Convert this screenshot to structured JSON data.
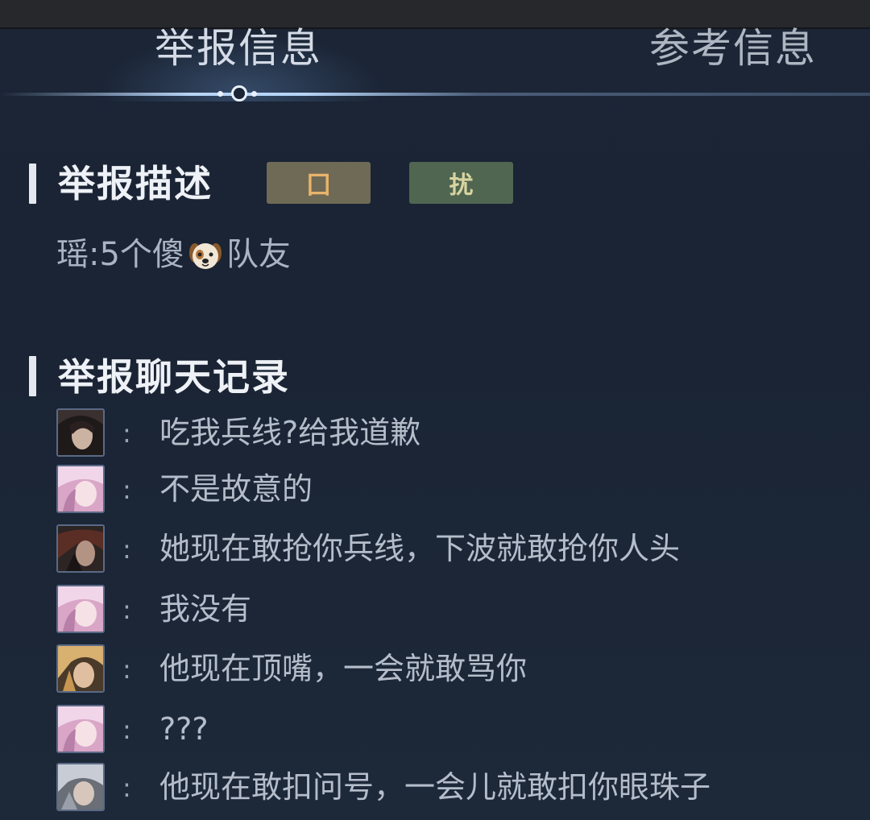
{
  "tabs": {
    "active_label": "举报信息",
    "inactive_label": "参考信息"
  },
  "report_description": {
    "title": "举报描述",
    "tags": [
      "囗",
      "扰"
    ],
    "text_before_icon": "瑶:5个傻",
    "icon": "dog-icon",
    "text_after_icon": "队友"
  },
  "chat_log": {
    "title": "举报聊天记录",
    "messages": [
      {
        "avatar": "avatar-dark-hooded",
        "colon": ":",
        "text": "吃我兵线?给我道歉"
      },
      {
        "avatar": "avatar-pink-yao",
        "colon": ":",
        "text": "不是故意的"
      },
      {
        "avatar": "avatar-dark-warrior",
        "colon": ":",
        "text": "她现在敢抢你兵线，下波就敢抢你人头"
      },
      {
        "avatar": "avatar-pink-yao",
        "colon": ":",
        "text": "我没有"
      },
      {
        "avatar": "avatar-blonde-hero",
        "colon": ":",
        "text": "他现在顶嘴，一会就敢骂你"
      },
      {
        "avatar": "avatar-pink-yao",
        "colon": ":",
        "text": "???"
      },
      {
        "avatar": "avatar-silver-hero",
        "colon": ":",
        "text": "他现在敢扣问号，一会儿就敢扣你眼珠子"
      }
    ]
  },
  "colors": {
    "background": "#1b2536",
    "tag_1_bg": "#6f6a56",
    "tag_2_bg": "#506650",
    "divider_glow": "#bedcff"
  }
}
